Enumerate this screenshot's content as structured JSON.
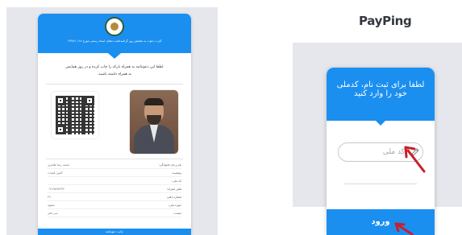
{
  "left_card": {
    "header_text": "کارت دعوت به همایش روز گرامیداشت دهقان اسناد رسمی مورخ ۱۳۹۷/۱۰/۱۸",
    "intro_line1": "لطفا این دعوتنامه به همراه بارکد را چاپ کرده و در روز همایش",
    "intro_line2": "به همراه داشته باشید.",
    "fields": [
      {
        "label": "نام و نام خانوادگی:",
        "value": "محمد رضا طاهری"
      },
      {
        "label": "وضعیت:",
        "value": "کانون قضات"
      },
      {
        "label": "کد ملی:",
        "value": ""
      },
      {
        "label": "تلفن همراه:",
        "value": "۰۹۱۳۵۲۵۳۲۹۲"
      },
      {
        "label": "شماره دفتر:",
        "value": "۳۹"
      },
      {
        "label": "حوزه ثبتی:",
        "value": "مشهد"
      },
      {
        "label": "سمت:",
        "value": "سر دفتر"
      }
    ],
    "print_button": "چاپ دعوتنامه"
  },
  "payping": {
    "logo_pay": "Pay",
    "logo_ping": "Ping",
    "title": "لطفا برای ثبت نام، کدملی خود را وارد کنید",
    "input_placeholder": "کد ملی",
    "login_button": "ورود"
  },
  "colors": {
    "accent": "#1a8ff0",
    "panel_bg": "#e6e7ed",
    "arrow": "#c8202a",
    "logo": "#33373f"
  }
}
